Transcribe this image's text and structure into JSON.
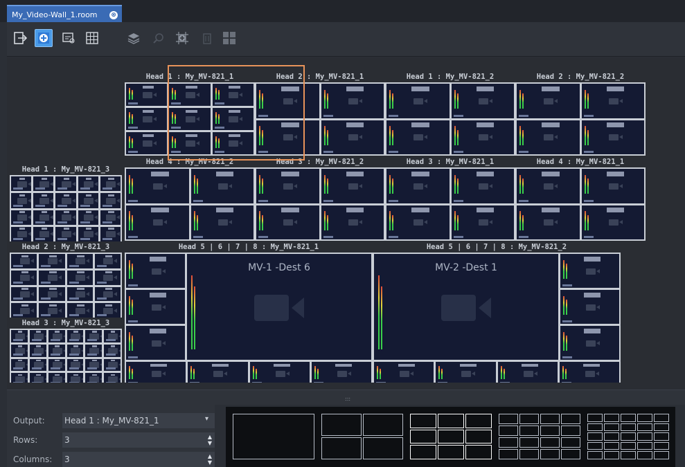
{
  "window": {
    "tab_title": "My_Video-Wall_1.room",
    "close_symbol": "⊗"
  },
  "toolbar": {
    "buttons": [
      {
        "name": "exit-icon",
        "state": "normal"
      },
      {
        "name": "add-head-icon",
        "state": "active"
      },
      {
        "name": "link-icon",
        "state": "normal"
      },
      {
        "name": "grid-icon",
        "state": "normal"
      },
      {
        "name": "layers-icon",
        "state": "disabled"
      },
      {
        "name": "zoom-icon",
        "state": "disabled"
      },
      {
        "name": "add-grid-icon",
        "state": "disabled"
      },
      {
        "name": "delete-icon",
        "state": "disabled"
      },
      {
        "name": "tile-icon",
        "state": "disabled"
      }
    ]
  },
  "wall": {
    "heads": [
      {
        "title": "Head 1 : My_MV-821_1",
        "rows": 3,
        "cols": 3
      },
      {
        "title": "Head 2 : My_MV-821_1",
        "rows": 2,
        "cols": 2
      },
      {
        "title": "Head 1 : My_MV-821_2",
        "rows": 2,
        "cols": 2
      },
      {
        "title": "Head 2 : My_MV-821_2",
        "rows": 2,
        "cols": 2
      },
      {
        "title": "Head 4 : My_MV-821_2",
        "rows": 2,
        "cols": 2
      },
      {
        "title": "Head 3 : My_MV-821_2",
        "rows": 2,
        "cols": 2
      },
      {
        "title": "Head 3 : My_MV-821_1",
        "rows": 2,
        "cols": 2
      },
      {
        "title": "Head 4 : My_MV-821_1",
        "rows": 2,
        "cols": 2
      },
      {
        "title": "Head 1 : My_MV-821_3",
        "rows": 4,
        "cols": 5
      },
      {
        "title": "Head 2 : My_MV-821_3",
        "rows": 4,
        "cols": 4
      },
      {
        "title": "Head 3 : My_MV-821_3",
        "rows": 4,
        "cols": 6
      }
    ],
    "big_heads": [
      {
        "title": "Head 5 | 6 | 7 | 8 : My_MV-821_1",
        "dest": "MV-1 -Dest 6"
      },
      {
        "title": "Head 5 | 6 | 7 | 8 : My_MV-821_2",
        "dest": "MV-2 -Dest 1"
      }
    ]
  },
  "properties": {
    "output_label": "Output:",
    "output_value": "Head 1 : My_MV-821_1",
    "rows_label": "Rows:",
    "rows_value": "3",
    "columns_label": "Columns:",
    "columns_value": "3"
  },
  "layout_presets": [
    {
      "rows": 1,
      "cols": 1,
      "selected": false
    },
    {
      "rows": 2,
      "cols": 2,
      "selected": false
    },
    {
      "rows": 3,
      "cols": 3,
      "selected": true
    },
    {
      "rows": 4,
      "cols": 4,
      "selected": false
    },
    {
      "rows": 5,
      "cols": 5,
      "selected": false
    }
  ],
  "colors": {
    "accent": "#3a6bb5",
    "selection": "#e8935a"
  }
}
